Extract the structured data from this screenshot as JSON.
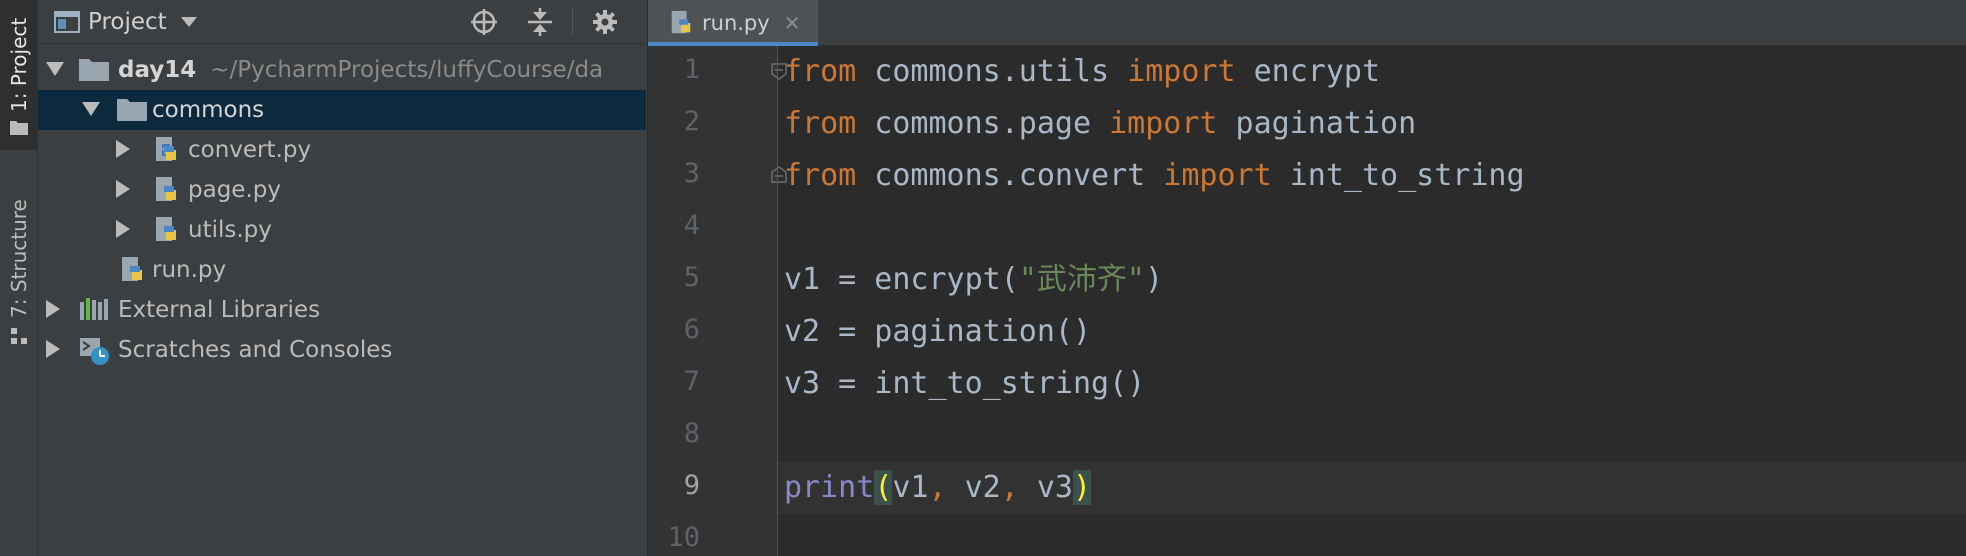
{
  "side_stripe": {
    "project_label": "1: Project",
    "structure_label": "7: Structure"
  },
  "project_panel": {
    "title": "Project",
    "tree": [
      {
        "name": "day14",
        "path": "~/PycharmProjects/luffyCourse/da",
        "type": "folder",
        "expanded": true
      },
      {
        "name": "commons",
        "type": "folder",
        "expanded": true,
        "selected": true
      },
      {
        "name": "convert.py",
        "type": "python-file",
        "expandable": true
      },
      {
        "name": "page.py",
        "type": "python-file",
        "expandable": true
      },
      {
        "name": "utils.py",
        "type": "python-file",
        "expandable": true
      },
      {
        "name": "run.py",
        "type": "python-file",
        "expandable": false
      },
      {
        "name": "External Libraries",
        "type": "libraries",
        "expandable": true
      },
      {
        "name": "Scratches and Consoles",
        "type": "scratches",
        "expandable": true
      }
    ]
  },
  "editor": {
    "tab": {
      "label": "run.py",
      "close_glyph": "✕"
    },
    "current_line": 9,
    "line_numbers": [
      "1",
      "2",
      "3",
      "4",
      "5",
      "6",
      "7",
      "8",
      "9",
      "10"
    ],
    "lines": [
      [
        {
          "t": "from",
          "c": "kw"
        },
        {
          "t": " commons.utils ",
          "c": ""
        },
        {
          "t": "import",
          "c": "kw"
        },
        {
          "t": " encrypt",
          "c": ""
        }
      ],
      [
        {
          "t": "from",
          "c": "kw"
        },
        {
          "t": " commons.page ",
          "c": ""
        },
        {
          "t": "import",
          "c": "kw"
        },
        {
          "t": " pagination",
          "c": ""
        }
      ],
      [
        {
          "t": "from",
          "c": "kw"
        },
        {
          "t": " commons.convert ",
          "c": ""
        },
        {
          "t": "import",
          "c": "kw"
        },
        {
          "t": " int_to_string",
          "c": ""
        }
      ],
      [],
      [
        {
          "t": "v1 = encrypt(",
          "c": ""
        },
        {
          "t": "\"武沛齐\"",
          "c": "str"
        },
        {
          "t": ")",
          "c": ""
        }
      ],
      [
        {
          "t": "v2 = pagination()",
          "c": ""
        }
      ],
      [
        {
          "t": "v3 = int_to_string()",
          "c": ""
        }
      ],
      [],
      [
        {
          "t": "print",
          "c": "builtin"
        },
        {
          "t": "(",
          "c": "paren-hl"
        },
        {
          "t": "v1",
          "c": ""
        },
        {
          "t": ",",
          "c": "kw"
        },
        {
          "t": " v2",
          "c": ""
        },
        {
          "t": ",",
          "c": "kw"
        },
        {
          "t": " v3",
          "c": ""
        },
        {
          "t": ")",
          "c": "paren-hl"
        }
      ],
      []
    ]
  },
  "colors": {
    "background": "#2b2b2b",
    "panel": "#3c3f41",
    "selection": "#0d293e",
    "keyword": "#cc7832",
    "string": "#6a8759",
    "builtin": "#8888c6",
    "text": "#a9b7c6"
  },
  "icons": {
    "header": [
      "project-view-icon",
      "dropdown-arrow-icon",
      "locate-icon",
      "collapse-all-icon",
      "settings-gear-icon",
      "hide-panel-icon"
    ]
  }
}
